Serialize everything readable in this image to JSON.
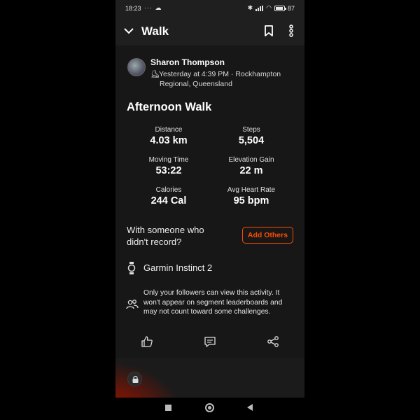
{
  "status_bar": {
    "time": "18:23",
    "notif_dots": "··· ☁",
    "battery": "87"
  },
  "app_bar": {
    "title": "Walk",
    "icons": [
      "chevron-down-icon",
      "bookmark-icon",
      "more-vertical-icon"
    ]
  },
  "activity": {
    "athlete": "Sharon Thompson",
    "meta_line1": "Yesterday at 4:39 PM · Rockhampton",
    "meta_line2": "Regional, Queensland",
    "title": "Afternoon Walk",
    "stats": [
      {
        "label": "Distance",
        "value": "4.03 km"
      },
      {
        "label": "Steps",
        "value": "5,504"
      },
      {
        "label": "Moving Time",
        "value": "53:22"
      },
      {
        "label": "Elevation Gain",
        "value": "22 m"
      },
      {
        "label": "Calories",
        "value": "244 Cal"
      },
      {
        "label": "Avg Heart Rate",
        "value": "95 bpm"
      }
    ],
    "with_line1": "With someone who",
    "with_line2": "didn't record?",
    "add_others": "Add Others",
    "device": "Garmin Instinct 2",
    "privacy": "Only your followers can view this activity. It won't appear on segment leaderboards and may not count toward some challenges."
  },
  "colors": {
    "accent": "#fc4c02",
    "background": "#171717"
  }
}
